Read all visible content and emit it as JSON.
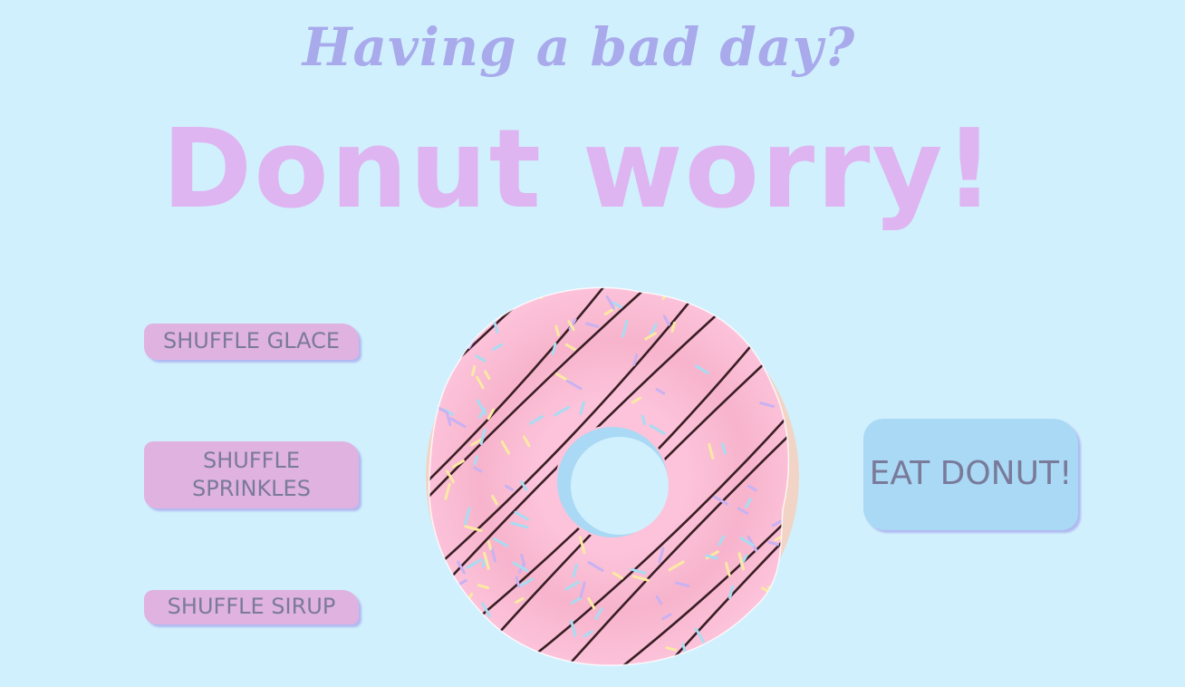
{
  "header": {
    "subtitle": "Having a bad day?",
    "title": "Donut worry!"
  },
  "controls": {
    "shuffle_glace": "SHUFFLE GLACE",
    "shuffle_sprinkles": "SHUFFLE SPRINKLES",
    "shuffle_sirup": "SHUFFLE SIRUP",
    "eat_donut": "EAT DONUT!"
  },
  "colors": {
    "background": "#d1f0fd",
    "subtitle": "#a8aaec",
    "title": "#deb5f1",
    "pink_button": "#e0b2e0",
    "eat_button": "#a9d9f5",
    "dough": "#f2d4c6",
    "glace": "#fcc3da",
    "sirup": "#3a1e24"
  },
  "donut": {
    "sprinkle_colors": [
      "#fbe9a4",
      "#a8dcf2",
      "#c8b2f2"
    ]
  }
}
